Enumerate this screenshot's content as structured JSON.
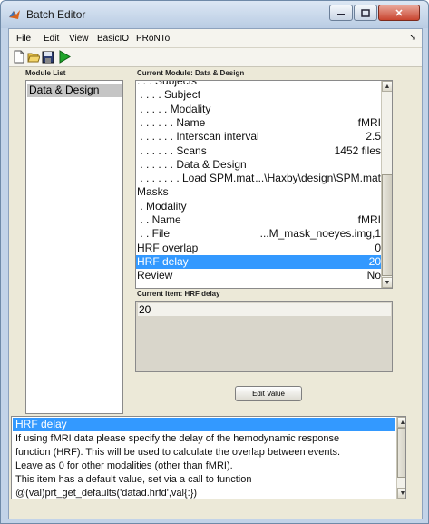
{
  "window": {
    "title": "Batch Editor",
    "close_label": "✕"
  },
  "menu": {
    "items": [
      "File",
      "Edit",
      "View",
      "BasicIO",
      "PRoNTo"
    ]
  },
  "toolbar": {
    "icons": [
      "new-file-icon",
      "open-folder-icon",
      "save-icon",
      "run-icon"
    ]
  },
  "module_list": {
    "heading": "Module List",
    "items": [
      "Data & Design"
    ]
  },
  "current_module": {
    "heading": "Current Module: Data & Design",
    "rows": [
      {
        "name": ". . . Subjects",
        "value": ""
      },
      {
        "name": " . . . . Subject",
        "value": ""
      },
      {
        "name": " . . . . . Modality",
        "value": ""
      },
      {
        "name": " . . . . . . Name",
        "value": "fMRI"
      },
      {
        "name": " . . . . . . Interscan interval",
        "value": "2.5"
      },
      {
        "name": " . . . . . . Scans",
        "value": "1452 files"
      },
      {
        "name": " . . . . . . Data & Design",
        "value": ""
      },
      {
        "name": " . . . . . . . Load SPM.mat",
        "value": "...\\Haxby\\design\\SPM.mat"
      },
      {
        "name": "Masks",
        "value": ""
      },
      {
        "name": " . Modality",
        "value": ""
      },
      {
        "name": " . . Name",
        "value": "fMRI"
      },
      {
        "name": " . . File",
        "value": "...M_mask_noeyes.img,1"
      },
      {
        "name": "HRF overlap",
        "value": "0"
      },
      {
        "name": "HRF delay",
        "value": "20"
      },
      {
        "name": "Review",
        "value": "No"
      }
    ],
    "selected_index": 13
  },
  "current_item": {
    "heading": "Current Item: HRF delay",
    "value": "20"
  },
  "edit_button": {
    "label": "Edit Value"
  },
  "help": {
    "title": "HRF delay",
    "lines": [
      "If  using  fMRI data please specify the delay of the hemodynamic response",
      "function  (HRF).  This  will  be used to calculate the overlap between events.",
      "Leave as 0 for other modalities (other than fMRI).",
      "This item has a default value, set via a call to function",
      "@(val)prt_get_defaults('datad.hrfd',val{:})"
    ]
  },
  "colors": {
    "selection": "#3399ff",
    "panel": "#ece9d8",
    "frame": "#c2d3e8"
  }
}
